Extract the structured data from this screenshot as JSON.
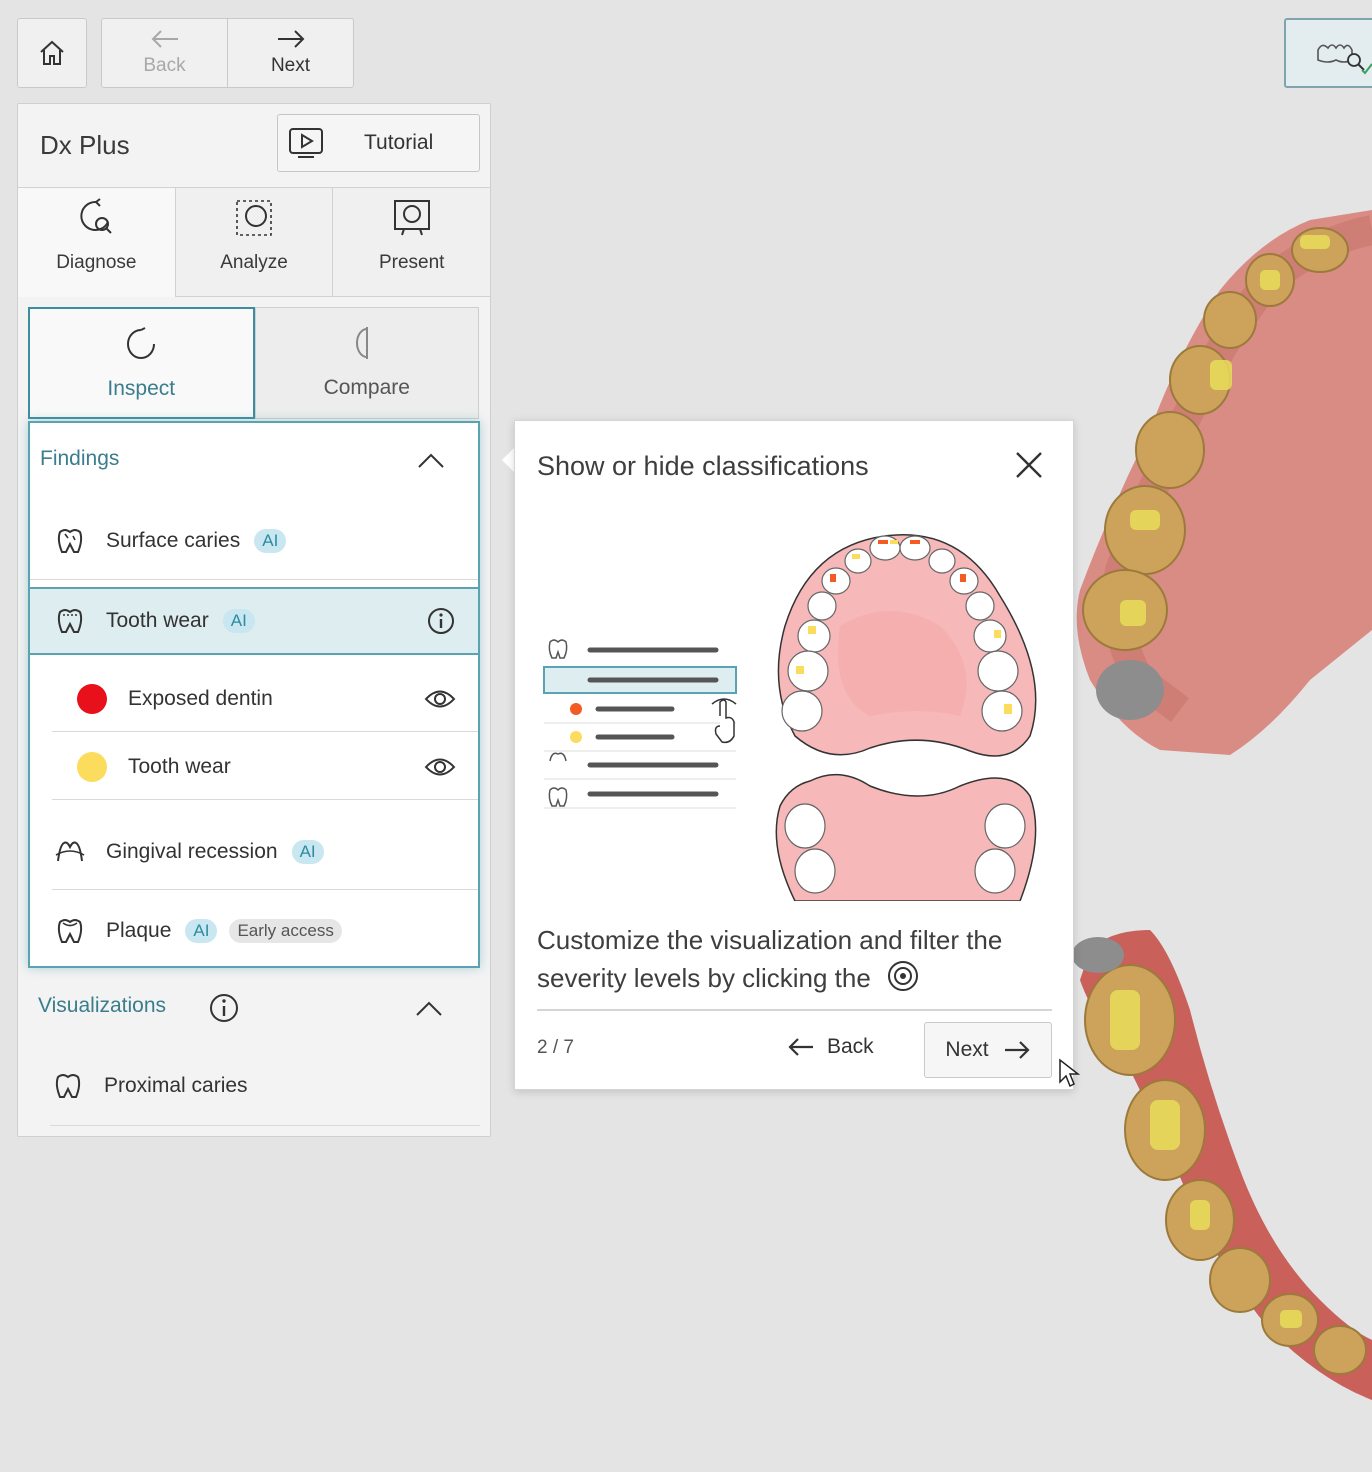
{
  "nav": {
    "back_label": "Back",
    "next_label": "Next"
  },
  "panel": {
    "title": "Dx Plus",
    "tutorial_label": "Tutorial",
    "tabs": [
      {
        "label": "Diagnose"
      },
      {
        "label": "Analyze"
      },
      {
        "label": "Present"
      }
    ],
    "modes": [
      {
        "label": "Inspect"
      },
      {
        "label": "Compare"
      }
    ],
    "findings": {
      "title": "Findings",
      "items": [
        {
          "label": "Surface caries",
          "badge": "AI"
        },
        {
          "label": "Tooth wear",
          "badge": "AI"
        },
        {
          "label": "Exposed dentin",
          "color": "#e8101a"
        },
        {
          "label": "Tooth wear",
          "color": "#fcdc5c"
        },
        {
          "label": "Gingival recession",
          "badge": "AI"
        },
        {
          "label": "Plaque",
          "badge": "AI",
          "badge2": "Early access"
        }
      ]
    },
    "visualizations": {
      "title": "Visualizations",
      "items": [
        {
          "label": "Proximal caries"
        }
      ]
    }
  },
  "popover": {
    "title": "Show or hide classifications",
    "description": "Customize the visualization and filter the severity levels by clicking the",
    "page_indicator": "2 / 7",
    "back_label": "Back",
    "next_label": "Next"
  },
  "colors": {
    "accent": "#3c8e9e",
    "badge_bg": "#c8e7f0",
    "exposed_dentin": "#e8101a",
    "tooth_wear": "#fcdc5c"
  }
}
